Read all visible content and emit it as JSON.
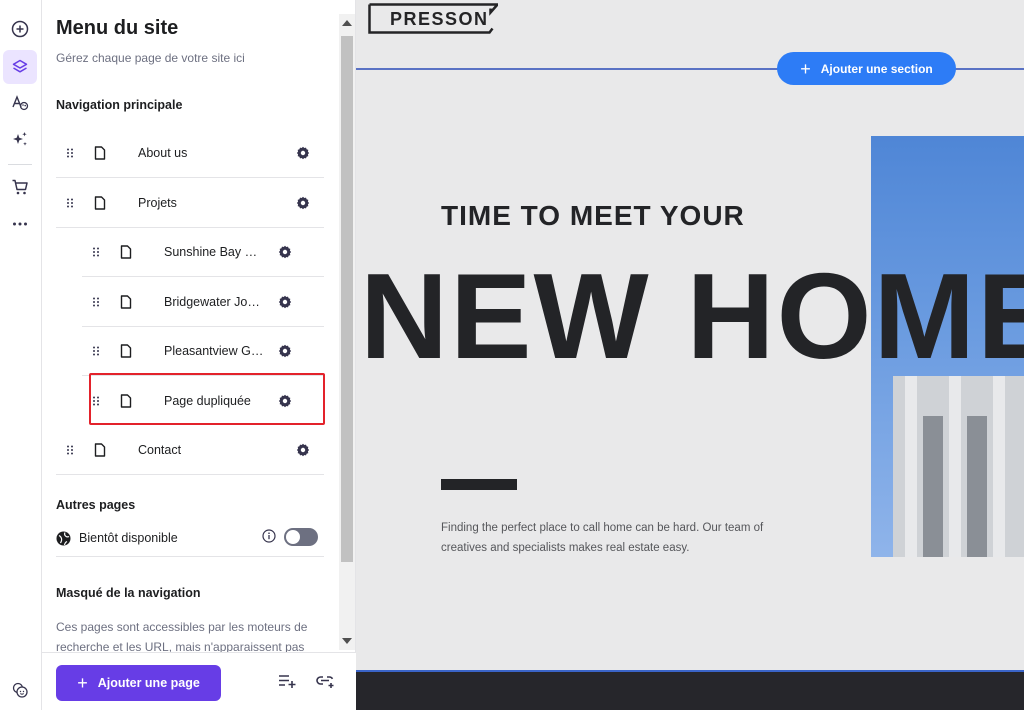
{
  "rail": {
    "items": [
      {
        "icon": "plus-circle-icon"
      },
      {
        "icon": "layers-icon",
        "active": true
      },
      {
        "icon": "typography-palette-icon"
      },
      {
        "icon": "sparkles-icon"
      },
      {
        "icon": "cart-icon"
      },
      {
        "icon": "more-icon"
      },
      {
        "icon": "help-face-icon"
      }
    ]
  },
  "panel": {
    "title": "Menu du site",
    "subtitle": "Gérez chaque page de votre site ici",
    "main_nav_title": "Navigation principale",
    "main_nav": [
      {
        "label": "About us",
        "level": 0
      },
      {
        "label": "Projets",
        "level": 0
      },
      {
        "label": "Sunshine Bay Re...",
        "level": 1
      },
      {
        "label": "Bridgewater Joy ...",
        "level": 1
      },
      {
        "label": "Pleasantview Ge...",
        "level": 1
      },
      {
        "label": "Page dupliquée",
        "level": 1,
        "highlighted": true
      },
      {
        "label": "Contact",
        "level": 0
      }
    ],
    "other_pages_title": "Autres pages",
    "other_pages": [
      {
        "label": "Bientôt disponible",
        "toggle_on": false
      }
    ],
    "hidden_title": "Masqué de la navigation",
    "hidden_desc": "Ces pages sont accessibles par les moteurs de recherche et les URL, mais n'apparaissent pas",
    "add_page_label": "Ajouter une page"
  },
  "canvas": {
    "logo": "PRESSON",
    "add_section_label": "Ajouter une section",
    "hero_small": "TIME TO MEET YOUR",
    "hero_big": "NEW HOME",
    "hero_para": "Finding the perfect place to call home can be hard. Our team of creatives and specialists makes real estate easy."
  },
  "colors": {
    "accent": "#673de6",
    "accent_light": "#ebe4ff",
    "section_button": "#2d7cf6",
    "highlight": "#e3222b",
    "canvas_bg": "#e9e9ea",
    "hero_text": "#232427"
  }
}
